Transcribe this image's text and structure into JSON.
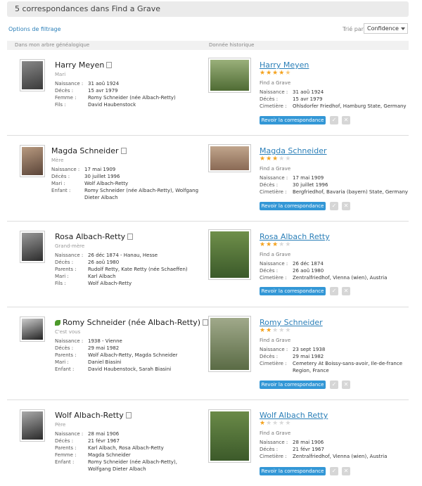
{
  "header": {
    "title": "5 correspondances dans Find a Grave"
  },
  "toolbar": {
    "filter_link": "Options de filtrage",
    "sort_label": "Trié par",
    "sort_value": "Confidence"
  },
  "columns": {
    "left": "Dans mon arbre généalogique",
    "right": "Donnée historique"
  },
  "labels": {
    "fag_source": "Find a Grave",
    "review_button": "Revoir la correspondance",
    "accept_mark": "✓",
    "reject_mark": "✕"
  },
  "matches": [
    {
      "left": {
        "name": "Harry Meyen",
        "relation": "Mari",
        "facts": [
          {
            "k": "Naissance :",
            "v": "31 aoû 1924"
          },
          {
            "k": "Décès :",
            "v": "15 avr 1979"
          },
          {
            "k": "Femme :",
            "v": "Romy Schneider (née Albach-Retty)"
          },
          {
            "k": "Fils :",
            "v": "David Haubenstock"
          }
        ]
      },
      "right": {
        "name": "Harry Meyen",
        "stars": 4.5,
        "facts": [
          {
            "k": "Naissance :",
            "v": "31 aoû 1924"
          },
          {
            "k": "Décès :",
            "v": "15 avr 1979"
          },
          {
            "k": "Cimetière :",
            "v": "Ohlsdorfer Friedhof, Hamburg State, Germany"
          }
        ]
      }
    },
    {
      "left": {
        "name": "Magda Schneider",
        "relation": "Mère",
        "facts": [
          {
            "k": "Naissance :",
            "v": "17 mai 1909"
          },
          {
            "k": "Décès :",
            "v": "30 juillet 1996"
          },
          {
            "k": "Mari :",
            "v": "Wolf Albach-Retty"
          },
          {
            "k": "Enfant :",
            "v": "Romy Schneider (née Albach-Retty), Wolfgang"
          },
          {
            "k": "",
            "v": "Dieter Albach"
          }
        ]
      },
      "right": {
        "name": "Magda Schneider",
        "stars": 3,
        "facts": [
          {
            "k": "Naissance :",
            "v": "17 mai 1909"
          },
          {
            "k": "Décès :",
            "v": "30 juillet 1996"
          },
          {
            "k": "Cimetière :",
            "v": "Bergfriedhof, Bavaria (bayern) State, Germany"
          }
        ]
      }
    },
    {
      "left": {
        "name": "Rosa Albach-Retty",
        "relation": "Grand-mère",
        "facts": [
          {
            "k": "Naissance :",
            "v": "26 déc 1874 - Hanau, Hesse"
          },
          {
            "k": "Décès :",
            "v": "26 aoû 1980"
          },
          {
            "k": "Parents :",
            "v": "Rudolf Retty, Kate Retty (née Schaeffen)"
          },
          {
            "k": "Mari :",
            "v": "Karl Albach"
          },
          {
            "k": "Fils :",
            "v": "Wolf Albach-Retty"
          }
        ]
      },
      "right": {
        "name": "Rosa Albach Retty",
        "stars": 3,
        "facts": [
          {
            "k": "Naissance :",
            "v": "26 déc 1874"
          },
          {
            "k": "Décès :",
            "v": "26 aoû 1980"
          },
          {
            "k": "Cimetière :",
            "v": "Zentralfriedhof, Vienna (wien), Austria"
          }
        ]
      }
    },
    {
      "left": {
        "name": "Romy Schneider (née Albach-Retty)",
        "relation": "C'est vous",
        "facts": [
          {
            "k": "Naissance :",
            "v": "1938 - Vienne"
          },
          {
            "k": "Décès :",
            "v": "29 mai 1982"
          },
          {
            "k": "Parents :",
            "v": "Wolf Albach-Retty, Magda Schneider"
          },
          {
            "k": "Mari :",
            "v": "Daniel Biasini"
          },
          {
            "k": "Enfant :",
            "v": "David Haubenstock, Sarah Biasini"
          }
        ]
      },
      "right": {
        "name": "Romy Schneider",
        "stars": 2,
        "facts": [
          {
            "k": "Naissance :",
            "v": "23 sept 1938"
          },
          {
            "k": "Décès :",
            "v": "29 mai 1982"
          },
          {
            "k": "Cimetière :",
            "v": "Cemetery At Boissy-sans-avoir, Ile-de-france"
          },
          {
            "k": "",
            "v": "Region, France"
          }
        ]
      }
    },
    {
      "left": {
        "name": "Wolf Albach-Retty",
        "relation": "Père",
        "facts": [
          {
            "k": "Naissance :",
            "v": "28 mai 1906"
          },
          {
            "k": "Décès :",
            "v": "21 févr 1967"
          },
          {
            "k": "Parents :",
            "v": "Karl Albach, Rosa Albach-Retty"
          },
          {
            "k": "Femme :",
            "v": "Magda Schneider"
          },
          {
            "k": "Enfant :",
            "v": "Romy Schneider (née Albach-Retty),"
          },
          {
            "k": "",
            "v": "Wolfgang Dieter Albach"
          }
        ]
      },
      "right": {
        "name": "Wolf Albach Retty",
        "stars": 1,
        "facts": [
          {
            "k": "Naissance :",
            "v": "28 mai 1906"
          },
          {
            "k": "Décès :",
            "v": "21 févr 1967"
          },
          {
            "k": "Cimetière :",
            "v": "Zentralfriedhof, Vienna (wien), Austria"
          }
        ]
      }
    }
  ]
}
